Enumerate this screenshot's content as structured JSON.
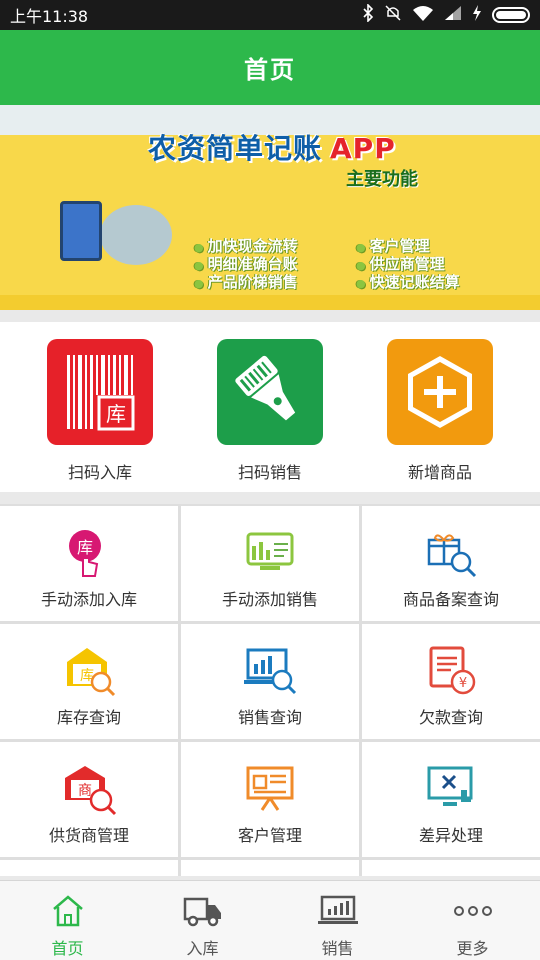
{
  "status_bar": {
    "time": "上午11:38"
  },
  "header": {
    "title": "首页"
  },
  "banner": {
    "headline": "农资简单记账",
    "headline_app": "APP",
    "subtitle": "主要功能",
    "features": [
      "加快现金流转",
      "明细准确台账",
      "产品阶梯销售",
      "客户管理",
      "供应商管理",
      "快速记账结算"
    ]
  },
  "quick_actions": [
    {
      "label": "扫码入库",
      "icon": "barcode-inbound-icon",
      "color": "#e62129",
      "badge": "库"
    },
    {
      "label": "扫码销售",
      "icon": "scanner-icon",
      "color": "#1d9e4a"
    },
    {
      "label": "新增商品",
      "icon": "add-product-icon",
      "color": "#f29a0e"
    }
  ],
  "grid": [
    {
      "label": "手动添加入库",
      "icon": "manual-inbound-icon"
    },
    {
      "label": "手动添加销售",
      "icon": "manual-sale-icon"
    },
    {
      "label": "商品备案查询",
      "icon": "product-record-icon"
    },
    {
      "label": "库存查询",
      "icon": "inventory-query-icon"
    },
    {
      "label": "销售查询",
      "icon": "sales-query-icon"
    },
    {
      "label": "欠款查询",
      "icon": "debt-query-icon"
    },
    {
      "label": "供货商管理",
      "icon": "supplier-icon"
    },
    {
      "label": "客户管理",
      "icon": "customer-icon"
    },
    {
      "label": "差异处理",
      "icon": "difference-icon"
    }
  ],
  "tabs": [
    {
      "label": "首页",
      "icon": "home-icon",
      "active": true
    },
    {
      "label": "入库",
      "icon": "truck-icon",
      "active": false
    },
    {
      "label": "销售",
      "icon": "sales-chart-icon",
      "active": false
    },
    {
      "label": "更多",
      "icon": "more-icon",
      "active": false
    }
  ],
  "colors": {
    "primary": "#2db84b",
    "banner": "#f8d84a"
  }
}
